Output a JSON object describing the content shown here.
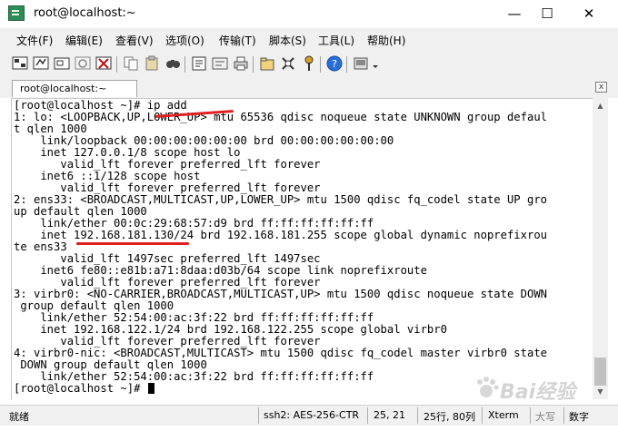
{
  "window": {
    "title": "root@localhost:~",
    "controls": {
      "minimize": "—",
      "maximize": "☐",
      "close": "✕"
    }
  },
  "menu": [
    "文件(F)",
    "编辑(E)",
    "查看(V)",
    "选项(O)",
    "传输(T)",
    "脚本(S)",
    "工具(L)",
    "帮助(H)"
  ],
  "tab": {
    "label": "root@localhost:~",
    "close": "x"
  },
  "terminal": {
    "lines": [
      "[root@localhost ~]# ip add",
      "1: lo: <LOOPBACK,UP,LOWER_UP> mtu 65536 qdisc noqueue state UNKNOWN group defaul",
      "t qlen 1000",
      "    link/loopback 00:00:00:00:00:00 brd 00:00:00:00:00:00",
      "    inet 127.0.0.1/8 scope host lo",
      "       valid_lft forever preferred_lft forever",
      "    inet6 ::1/128 scope host",
      "       valid_lft forever preferred_lft forever",
      "2: ens33: <BROADCAST,MULTICAST,UP,LOWER_UP> mtu 1500 qdisc fq_codel state UP gro",
      "up default qlen 1000",
      "    link/ether 00:0c:29:68:57:d9 brd ff:ff:ff:ff:ff:ff",
      "    inet 192.168.181.130/24 brd 192.168.181.255 scope global dynamic noprefixrou",
      "te ens33",
      "       valid_lft 1497sec preferred_lft 1497sec",
      "    inet6 fe80::e81b:a71:8daa:d03b/64 scope link noprefixroute",
      "       valid_lft forever preferred_lft forever",
      "3: virbr0: <NO-CARRIER,BROADCAST,MULTICAST,UP> mtu 1500 qdisc noqueue state DOWN",
      " group default qlen 1000",
      "    link/ether 52:54:00:ac:3f:22 brd ff:ff:ff:ff:ff:ff",
      "    inet 192.168.122.1/24 brd 192.168.122.255 scope global virbr0",
      "       valid_lft forever preferred_lft forever",
      "4: virbr0-nic: <BROADCAST,MULTICAST> mtu 1500 qdisc fq_codel master virbr0 state",
      " DOWN group default qlen 1000",
      "    link/ether 52:54:00:ac:3f:22 brd ff:ff:ff:ff:ff:ff"
    ],
    "prompt": "[root@localhost ~]# "
  },
  "statusbar": {
    "ready": "就绪",
    "session": "ssh2: AES-256-CTR",
    "cursor_pos": "25,  21",
    "rows_cols": "25行, 80列",
    "terminal_type": "Xterm",
    "caps": "大写",
    "num": "数字"
  },
  "watermark": "Bai经验",
  "colors": {
    "annotation": "#e02020",
    "chrome": "#f0f0f0"
  }
}
